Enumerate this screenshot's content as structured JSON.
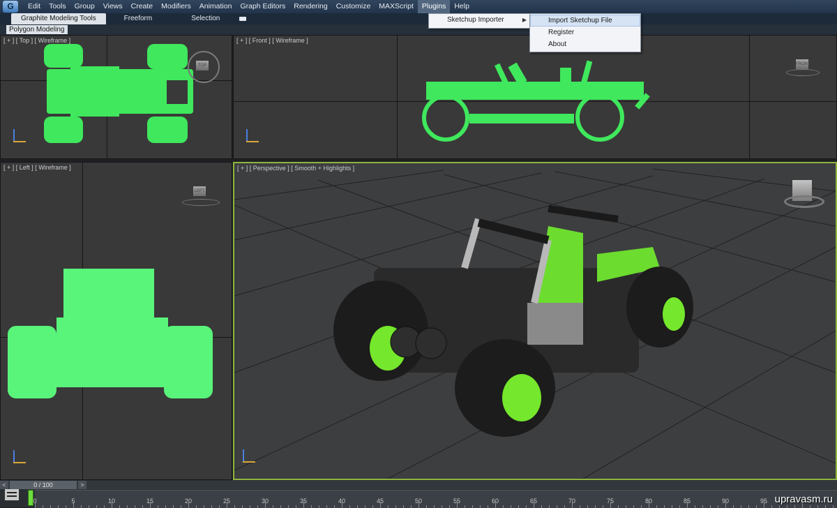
{
  "menubar": {
    "logo": "G",
    "items": [
      "Edit",
      "Tools",
      "Group",
      "Views",
      "Create",
      "Modifiers",
      "Animation",
      "Graph Editors",
      "Rendering",
      "Customize",
      "MAXScript",
      "Plugins",
      "Help"
    ],
    "active_item": "Plugins"
  },
  "ribbon": {
    "tabs": [
      "Graphite Modeling Tools",
      "Freeform",
      "Selection"
    ],
    "active_tab": "Graphite Modeling Tools",
    "sub_tab": "Polygon Modeling"
  },
  "plugins_menu": {
    "items": [
      {
        "label": "Sketchup Importer",
        "has_submenu": true
      }
    ]
  },
  "sketchup_submenu": {
    "items": [
      "Import Sketchup File",
      "Register",
      "About"
    ],
    "highlighted": "Import Sketchup File"
  },
  "viewports": {
    "top": {
      "label": "[ + ] [ Top ] [ Wireframe ]",
      "cube": "TOP"
    },
    "front": {
      "label": "[ + ] [ Front ] [ Wireframe ]",
      "cube": "FRONT"
    },
    "left": {
      "label": "[ + ] [ Left ] [ Wireframe ]",
      "cube": "LEFT"
    },
    "perspective": {
      "label": "[ + ] [ Perspective ] [ Smooth + Highlights ]"
    }
  },
  "time_slider": {
    "value": "0 / 100",
    "prev": "<",
    "next": ">"
  },
  "timeline": {
    "ticks": [
      "0",
      "5",
      "10",
      "15",
      "20",
      "25",
      "30",
      "35",
      "40",
      "45",
      "50",
      "55",
      "60",
      "65",
      "70",
      "75",
      "80",
      "85",
      "90",
      "95"
    ]
  },
  "watermark": "upravasm.ru",
  "colors": {
    "wireframe": "#3fe85c",
    "active_viewport_border": "#8fb53e",
    "menubar": "#31455e"
  }
}
